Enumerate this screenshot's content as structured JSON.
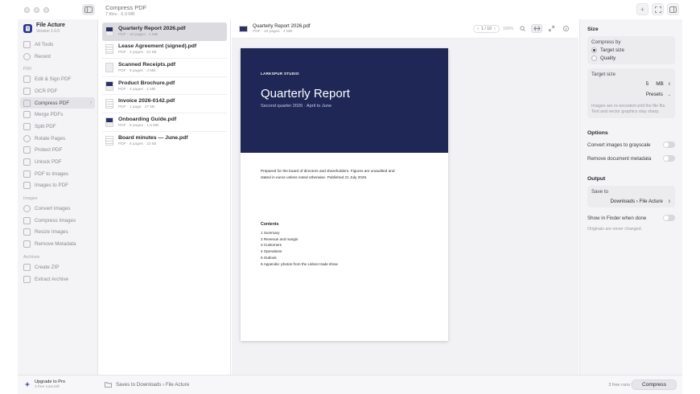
{
  "window": {
    "title": "Compress PDF",
    "subtitle": "7 files · 6.9 MB"
  },
  "sidebar": {
    "app_name": "File Acture",
    "app_version": "Version 1.0.0",
    "top_items": [
      {
        "label": "All Tools",
        "icon": "grid-icon"
      },
      {
        "label": "Recent",
        "icon": "clock-icon"
      }
    ],
    "sections": [
      {
        "title": "PDF",
        "items": [
          {
            "label": "Edit & Sign PDF",
            "icon": "pen-icon"
          },
          {
            "label": "OCR PDF",
            "icon": "scan-text-icon"
          },
          {
            "label": "Compress PDF",
            "icon": "compress-icon",
            "active": true
          },
          {
            "label": "Merge PDFs",
            "icon": "merge-icon"
          },
          {
            "label": "Split PDF",
            "icon": "split-icon"
          },
          {
            "label": "Rotate Pages",
            "icon": "rotate-icon"
          },
          {
            "label": "Protect PDF",
            "icon": "lock-icon"
          },
          {
            "label": "Unlock PDF",
            "icon": "unlock-icon"
          },
          {
            "label": "PDF to Images",
            "icon": "image-icon"
          },
          {
            "label": "Images to PDF",
            "icon": "file-icon"
          }
        ]
      },
      {
        "title": "Images",
        "items": [
          {
            "label": "Convert Images",
            "icon": "convert-icon"
          },
          {
            "label": "Compress Images",
            "icon": "compress-image-icon"
          },
          {
            "label": "Resize Images",
            "icon": "resize-icon"
          },
          {
            "label": "Remove Metadata",
            "icon": "eraser-icon"
          }
        ]
      },
      {
        "title": "Archives",
        "items": [
          {
            "label": "Create ZIP",
            "icon": "zip-icon"
          },
          {
            "label": "Extract Archive",
            "icon": "archive-icon"
          }
        ]
      }
    ]
  },
  "files": [
    {
      "name": "Quarterly Report 2026.pdf",
      "meta": "PDF · 10 pages · 4 MB",
      "thumb": "dark",
      "selected": true
    },
    {
      "name": "Lease Agreement (signed).pdf",
      "meta": "PDF · 2 pages · 51 kB",
      "thumb": "lines"
    },
    {
      "name": "Scanned Receipts.pdf",
      "meta": "PDF · 8 pages · 3 MB",
      "thumb": "plain"
    },
    {
      "name": "Product Brochure.pdf",
      "meta": "PDF · 4 pages · 1 MB",
      "thumb": "dark"
    },
    {
      "name": "Invoice 2026-0142.pdf",
      "meta": "PDF · 1 page · 27 kB",
      "thumb": "lines"
    },
    {
      "name": "Onboarding Guide.pdf",
      "meta": "PDF · 5 pages · 1.6 MB",
      "thumb": "dark"
    },
    {
      "name": "Board minutes — June.pdf",
      "meta": "PDF · 6 pages · 23 kB",
      "thumb": "lines"
    }
  ],
  "preview": {
    "file_name": "Quarterly Report 2026.pdf",
    "file_meta": "PDF · 10 pages · 4 MB",
    "page_indicator": "1 / 10",
    "zoom": "100%",
    "document": {
      "studio": "LARKSPUR STUDIO",
      "title": "Quarterly Report",
      "subtitle": "Second quarter 2026 · April to June",
      "intro": "Prepared for the board of directors and shareholders. Figures are unaudited and stated in euros unless noted otherwise. Published 21 July 2026.",
      "contents_heading": "Contents",
      "contents": [
        "1  Summary",
        "2  Revenue and margin",
        "3  Customers",
        "4  Operations",
        "5  Outlook",
        "6  Appendix: photos from the Lisbon trade show"
      ]
    }
  },
  "settings": {
    "size_heading": "Size",
    "compress_by_label": "Compress by",
    "option_target": "Target size",
    "option_quality": "Quality",
    "target_size_label": "Target size",
    "target_value": "5",
    "target_unit": "MB",
    "presets_label": "Presets",
    "size_hint": "Images are re-encoded until the file fits. Text and vector graphics stay sharp.",
    "options_heading": "Options",
    "grayscale_label": "Convert images to grayscale",
    "metadata_label": "Remove document metadata",
    "output_heading": "Output",
    "save_to_label": "Save to",
    "save_to_value": "Downloads › File Acture",
    "show_finder_label": "Show in Finder when done",
    "output_hint": "Originals are never changed."
  },
  "footer": {
    "upgrade_title": "Upgrade to Pro",
    "upgrade_sub": "3 free runs left",
    "saves_to": "Saves to Downloads › File Acture",
    "runs_left": "3 free runs left",
    "compress_button": "Compress"
  }
}
